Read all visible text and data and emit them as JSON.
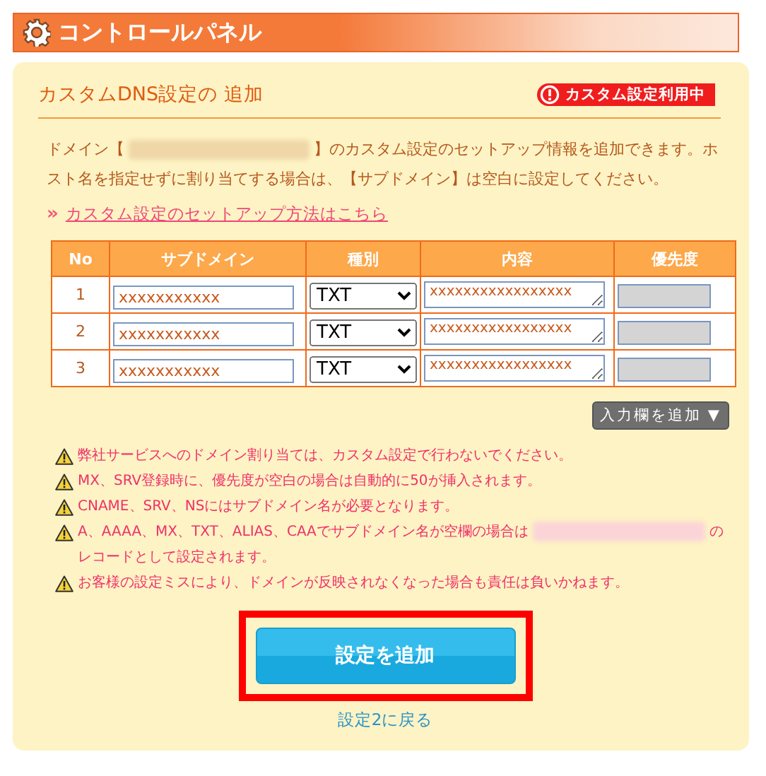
{
  "header": {
    "title": "コントロールパネル"
  },
  "section": {
    "title": "カスタムDNS設定の 追加",
    "badge": "カスタム設定利用中"
  },
  "intro": {
    "before": "ドメイン【",
    "after": "】のカスタム設定のセットアップ情報を追加できます。ホスト名を指定せずに割り当てする場合は、【サブドメイン】は空白に設定してください。",
    "redacted": true
  },
  "help_link": {
    "icon": "»",
    "label": "カスタム設定のセットアップ方法はこちら"
  },
  "table": {
    "columns": [
      "No",
      "サブドメイン",
      "種別",
      "内容",
      "優先度"
    ],
    "rows": [
      {
        "no": "1",
        "subdomain": "xxxxxxxxxxx",
        "type": "TXT",
        "content": "xxxxxxxxxxxxxxxxx",
        "priority_disabled": true
      },
      {
        "no": "2",
        "subdomain": "xxxxxxxxxxx",
        "type": "TXT",
        "content": "xxxxxxxxxxxxxxxxx",
        "priority_disabled": true
      },
      {
        "no": "3",
        "subdomain": "xxxxxxxxxxx",
        "type": "TXT",
        "content": "xxxxxxxxxxxxxxxxx",
        "priority_disabled": true
      }
    ]
  },
  "add_rows_button": {
    "label": "入力欄を追加",
    "icon": "▼"
  },
  "warnings": [
    {
      "text": "弊社サービスへのドメイン割り当ては、カスタム設定で行わないでください。"
    },
    {
      "text": "MX、SRV登録時に、優先度が空白の場合は自動的に50が挿入されます。"
    },
    {
      "text": "CNAME、SRV、NSにはサブドメイン名が必要となります。"
    },
    {
      "text": "A、AAAA、MX、TXT、ALIAS、CAAでサブドメイン名が空欄の場合は",
      "redacted": true,
      "after": "のレコードとして設定されます。"
    },
    {
      "text": "お客様の設定ミスにより、ドメインが反映されなくなった場合も責任は負いかねます。"
    }
  ],
  "submit_button": {
    "label": "設定を追加",
    "highlighted": true
  },
  "back_link": {
    "label": "設定2に戻る"
  }
}
